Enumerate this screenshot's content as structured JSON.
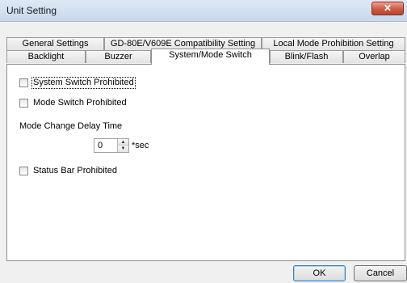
{
  "window": {
    "title": "Unit Setting",
    "close_symbol": "✕"
  },
  "tabs": {
    "row1": [
      {
        "label": "General Settings"
      },
      {
        "label": "GD-80E/V609E Compatibility Setting"
      },
      {
        "label": "Local Mode Prohibition Setting"
      }
    ],
    "row2": [
      {
        "label": "Backlight"
      },
      {
        "label": "Buzzer"
      },
      {
        "label": "System/Mode Switch",
        "active": true
      },
      {
        "label": "Blink/Flash"
      },
      {
        "label": "Overlap"
      }
    ]
  },
  "panel": {
    "system_switch_label": "System Switch Prohibited",
    "system_switch_checked": false,
    "mode_switch_label": "Mode Switch Prohibited",
    "mode_switch_checked": false,
    "delay_label": "Mode Change Delay Time",
    "delay_value": "0",
    "delay_unit": "*sec",
    "status_bar_label": "Status Bar Prohibited",
    "status_bar_checked": false
  },
  "buttons": {
    "ok_label": "OK",
    "cancel_label": "Cancel"
  },
  "colors": {
    "close_button": "#c1432b",
    "titlebar": "#c7d8ec",
    "panel": "#ffffff"
  },
  "icons": {
    "close": "close-icon",
    "spin_up": "spin-up-icon",
    "spin_down": "spin-down-icon"
  }
}
